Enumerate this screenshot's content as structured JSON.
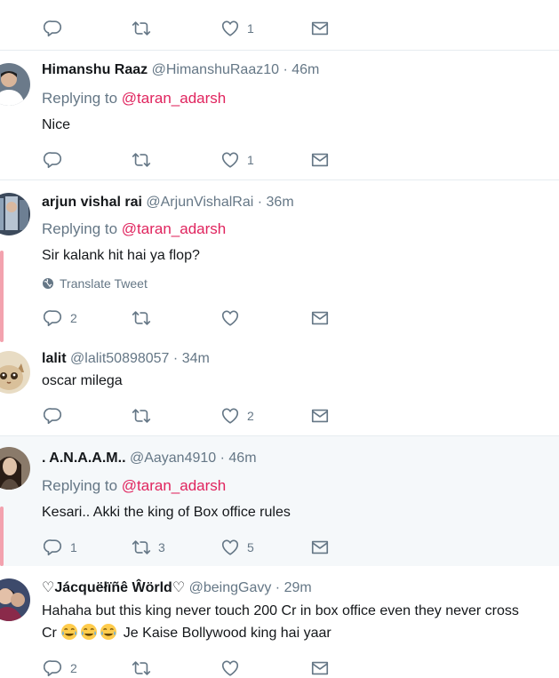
{
  "top_partial": {
    "like_count": "1"
  },
  "tweets": [
    {
      "name": "Himanshu Raaz",
      "handle": "@HimanshuRaaz10",
      "dot": "·",
      "time": "46m",
      "replying_prefix": "Replying to",
      "replying_to": "@taran_adarsh",
      "text": "Nice",
      "reply_count": "",
      "retweet_count": "",
      "like_count": "1"
    },
    {
      "name": "arjun vishal rai",
      "handle": "@ArjunVishalRai",
      "dot": "·",
      "time": "36m",
      "replying_prefix": "Replying to",
      "replying_to": "@taran_adarsh",
      "text": "Sir kalank hit hai ya flop?",
      "translate_label": "Translate Tweet",
      "reply_count": "2",
      "retweet_count": "",
      "like_count": ""
    },
    {
      "name": "lalit",
      "handle": "@lalit50898057",
      "dot": "·",
      "time": "34m",
      "text": "oscar milega",
      "reply_count": "",
      "retweet_count": "",
      "like_count": "2"
    },
    {
      "name": ". A.N.A.A.M..",
      "handle": "@Aayan4910",
      "dot": "·",
      "time": "46m",
      "replying_prefix": "Replying to",
      "replying_to": "@taran_adarsh",
      "text": "Kesari.. Akki the king of Box office rules",
      "reply_count": "1",
      "retweet_count": "3",
      "like_count": "5"
    },
    {
      "name": "♡Jácquëłïñê Ŵörld♡",
      "handle": "@beingGavy",
      "dot": "·",
      "time": "29m",
      "text_line1": "Hahaha but this king never touch 200 Cr in box office even they never cross",
      "text_line2_prefix": "Cr",
      "text_line2_suffix": "Je Kaise Bollywood king hai yaar",
      "reply_count": "2"
    }
  ],
  "icons": {
    "reply": "reply-icon",
    "retweet": "retweet-icon",
    "like": "heart-icon",
    "dm": "envelope-icon",
    "globe": "globe-icon",
    "emoji": "laughing-tears-emoji"
  },
  "colors": {
    "mention": "#e0245e",
    "secondary": "#657786",
    "thread_line": "#f3a2ae",
    "highlight_bg": "#f5f8fa"
  }
}
